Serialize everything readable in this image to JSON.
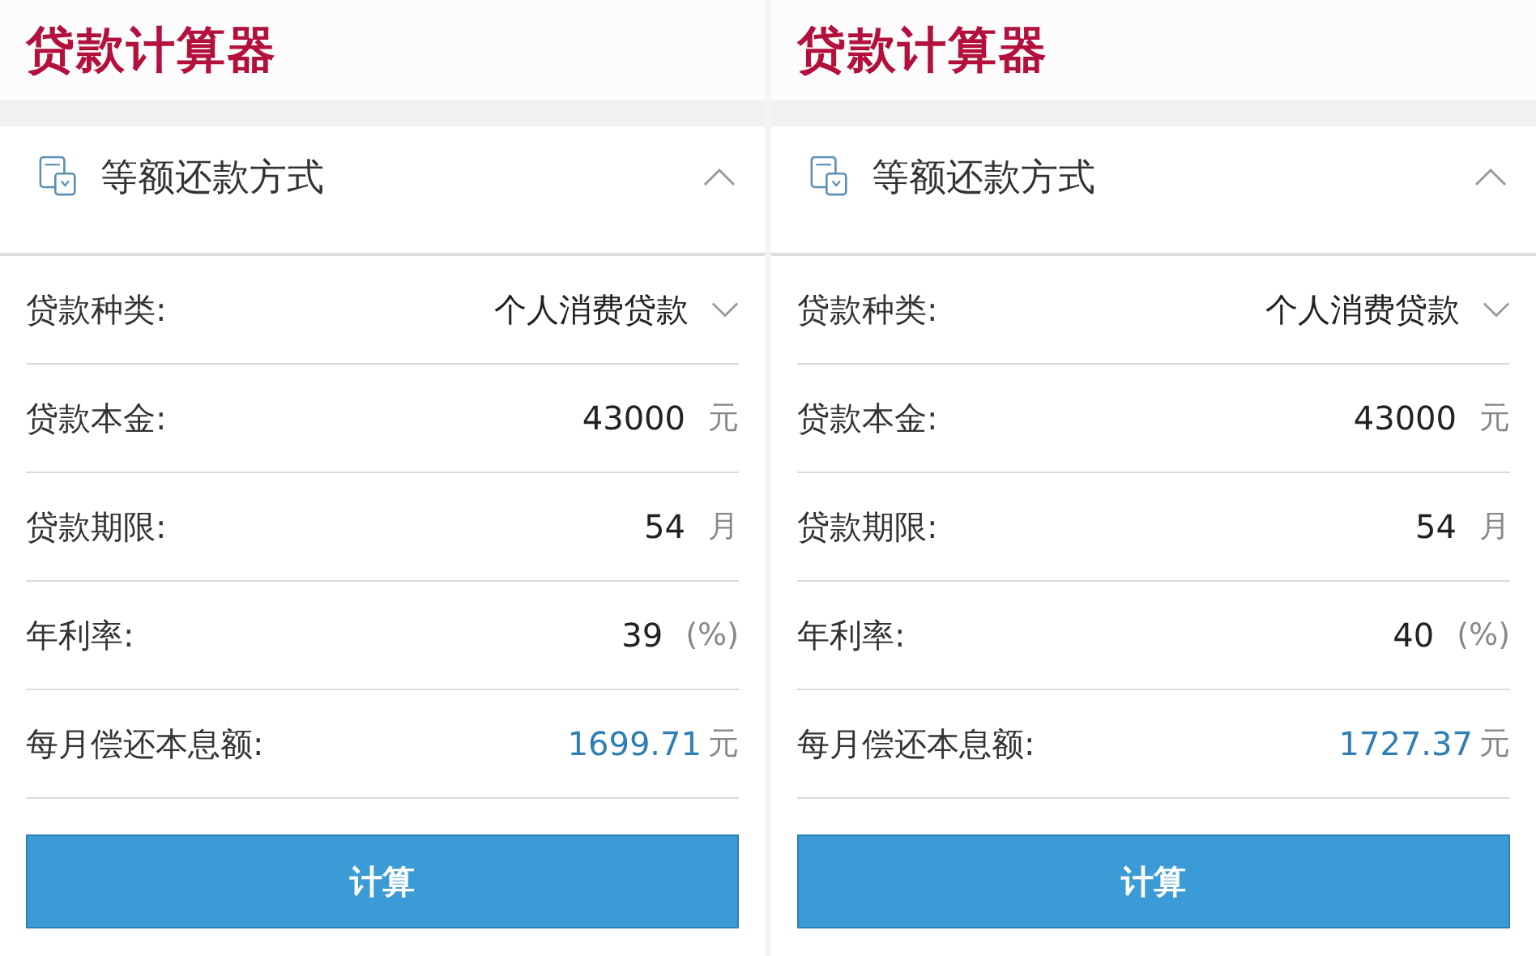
{
  "panels": [
    {
      "title": "贷款计算器",
      "section": {
        "label": "等额还款方式",
        "expanded": true
      },
      "rows": [
        {
          "kind": "select",
          "label": "贷款种类:",
          "value": "个人消费贷款"
        },
        {
          "kind": "input",
          "label": "贷款本金:",
          "value": "43000",
          "unit": "元"
        },
        {
          "kind": "input",
          "label": "贷款期限:",
          "value": "54",
          "unit": "月"
        },
        {
          "kind": "input",
          "label": "年利率:",
          "value": "39",
          "unit": "(%)"
        },
        {
          "kind": "result",
          "label": "每月偿还本息额:",
          "value": "1699.71",
          "unit": "元"
        }
      ],
      "button": "计算"
    },
    {
      "title": "贷款计算器",
      "section": {
        "label": "等额还款方式",
        "expanded": true
      },
      "rows": [
        {
          "kind": "select",
          "label": "贷款种类:",
          "value": "个人消费贷款"
        },
        {
          "kind": "input",
          "label": "贷款本金:",
          "value": "43000",
          "unit": "元"
        },
        {
          "kind": "input",
          "label": "贷款期限:",
          "value": "54",
          "unit": "月"
        },
        {
          "kind": "input",
          "label": "年利率:",
          "value": "40",
          "unit": "(%)"
        },
        {
          "kind": "result",
          "label": "每月偿还本息额:",
          "value": "1727.37",
          "unit": "元"
        }
      ],
      "button": "计算"
    }
  ]
}
